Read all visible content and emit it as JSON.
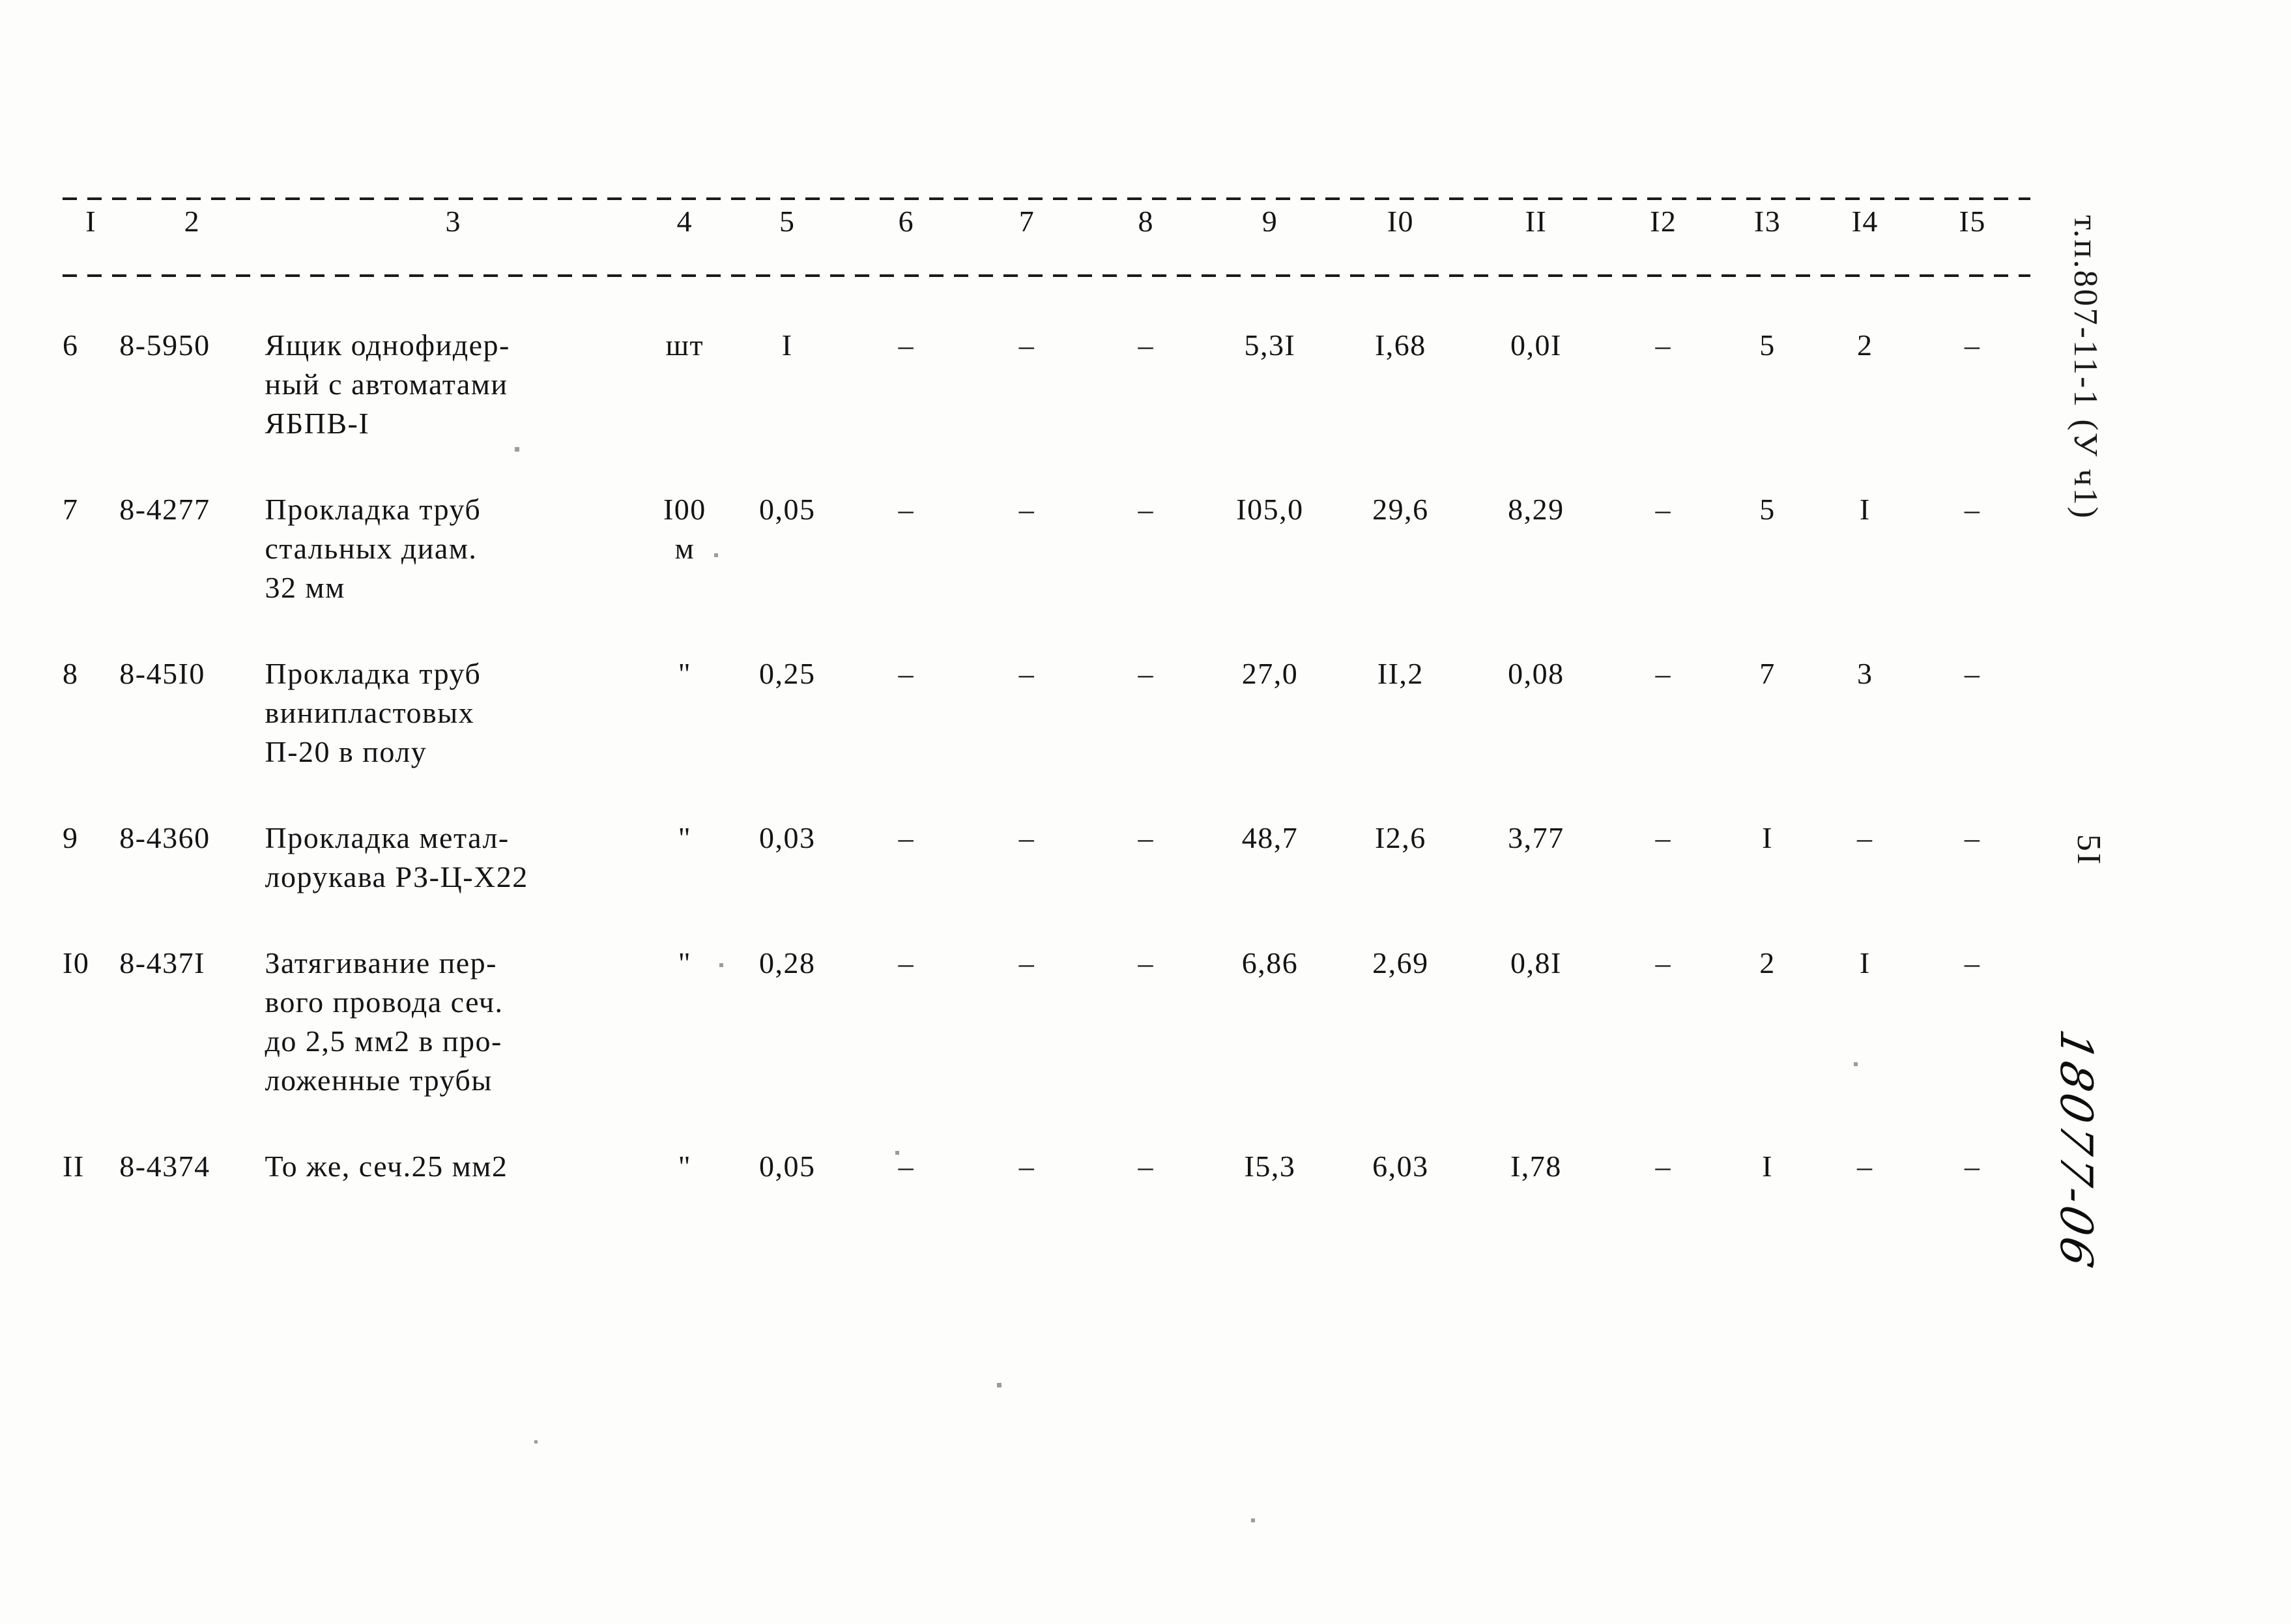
{
  "document": {
    "sheet_code_margin": "т.п.807-11-1 (У ч1)",
    "page_number_margin": "5I",
    "handwritten_margin": "18077-06"
  },
  "table": {
    "column_headers": [
      "I",
      "2",
      "3",
      "4",
      "5",
      "6",
      "7",
      "8",
      "9",
      "I0",
      "II",
      "I2",
      "I3",
      "I4",
      "I5"
    ],
    "rows": [
      {
        "num": "6",
        "code": "8-5950",
        "desc_lines": [
          "Ящик однофидер-",
          "ный с автоматами",
          "ЯБПВ-I"
        ],
        "unit_lines": [
          "",
          "",
          "шт"
        ],
        "values": [
          "I",
          "–",
          "–",
          "–",
          "5,3I",
          "I,68",
          "0,0I",
          "–",
          "5",
          "2",
          "–"
        ]
      },
      {
        "num": "7",
        "code": "8-4277",
        "desc_lines": [
          "Прокладка труб",
          "стальных диам.",
          "32 мм"
        ],
        "unit_lines": [
          "",
          "I00",
          "м"
        ],
        "values": [
          "0,05",
          "–",
          "–",
          "–",
          "I05,0",
          "29,6",
          "8,29",
          "–",
          "5",
          "I",
          "–"
        ]
      },
      {
        "num": "8",
        "code": "8-45I0",
        "desc_lines": [
          "Прокладка труб",
          "винипластовых",
          "П-20 в полу"
        ],
        "unit_lines": [
          "",
          "",
          "\""
        ],
        "values": [
          "0,25",
          "–",
          "–",
          "–",
          "27,0",
          "II,2",
          "0,08",
          "–",
          "7",
          "3",
          "–"
        ]
      },
      {
        "num": "9",
        "code": "8-4360",
        "desc_lines": [
          "Прокладка метал-",
          "лорукава РЗ-Ц-Х22"
        ],
        "unit_lines": [
          "",
          "\""
        ],
        "values": [
          "0,03",
          "–",
          "–",
          "–",
          "48,7",
          "I2,6",
          "3,77",
          "–",
          "I",
          "–",
          "–"
        ]
      },
      {
        "num": "I0",
        "code": "8-437I",
        "desc_lines": [
          "Затягивание пер-",
          "вого провода сеч.",
          "до 2,5 мм2 в про-",
          "ложенные трубы"
        ],
        "unit_lines": [
          "",
          "",
          "",
          "\""
        ],
        "values": [
          "0,28",
          "–",
          "–",
          "–",
          "6,86",
          "2,69",
          "0,8I",
          "–",
          "2",
          "I",
          "–"
        ]
      },
      {
        "num": "II",
        "code": "8-4374",
        "desc_lines": [
          "То же, сеч.25 мм2"
        ],
        "unit_lines": [
          "\""
        ],
        "values": [
          "0,05",
          "–",
          "–",
          "–",
          "I5,3",
          "6,03",
          "I,78",
          "–",
          "I",
          "–",
          "–"
        ]
      }
    ]
  },
  "colors": {
    "ink": "#141414",
    "paper": "#fdfdfc"
  }
}
